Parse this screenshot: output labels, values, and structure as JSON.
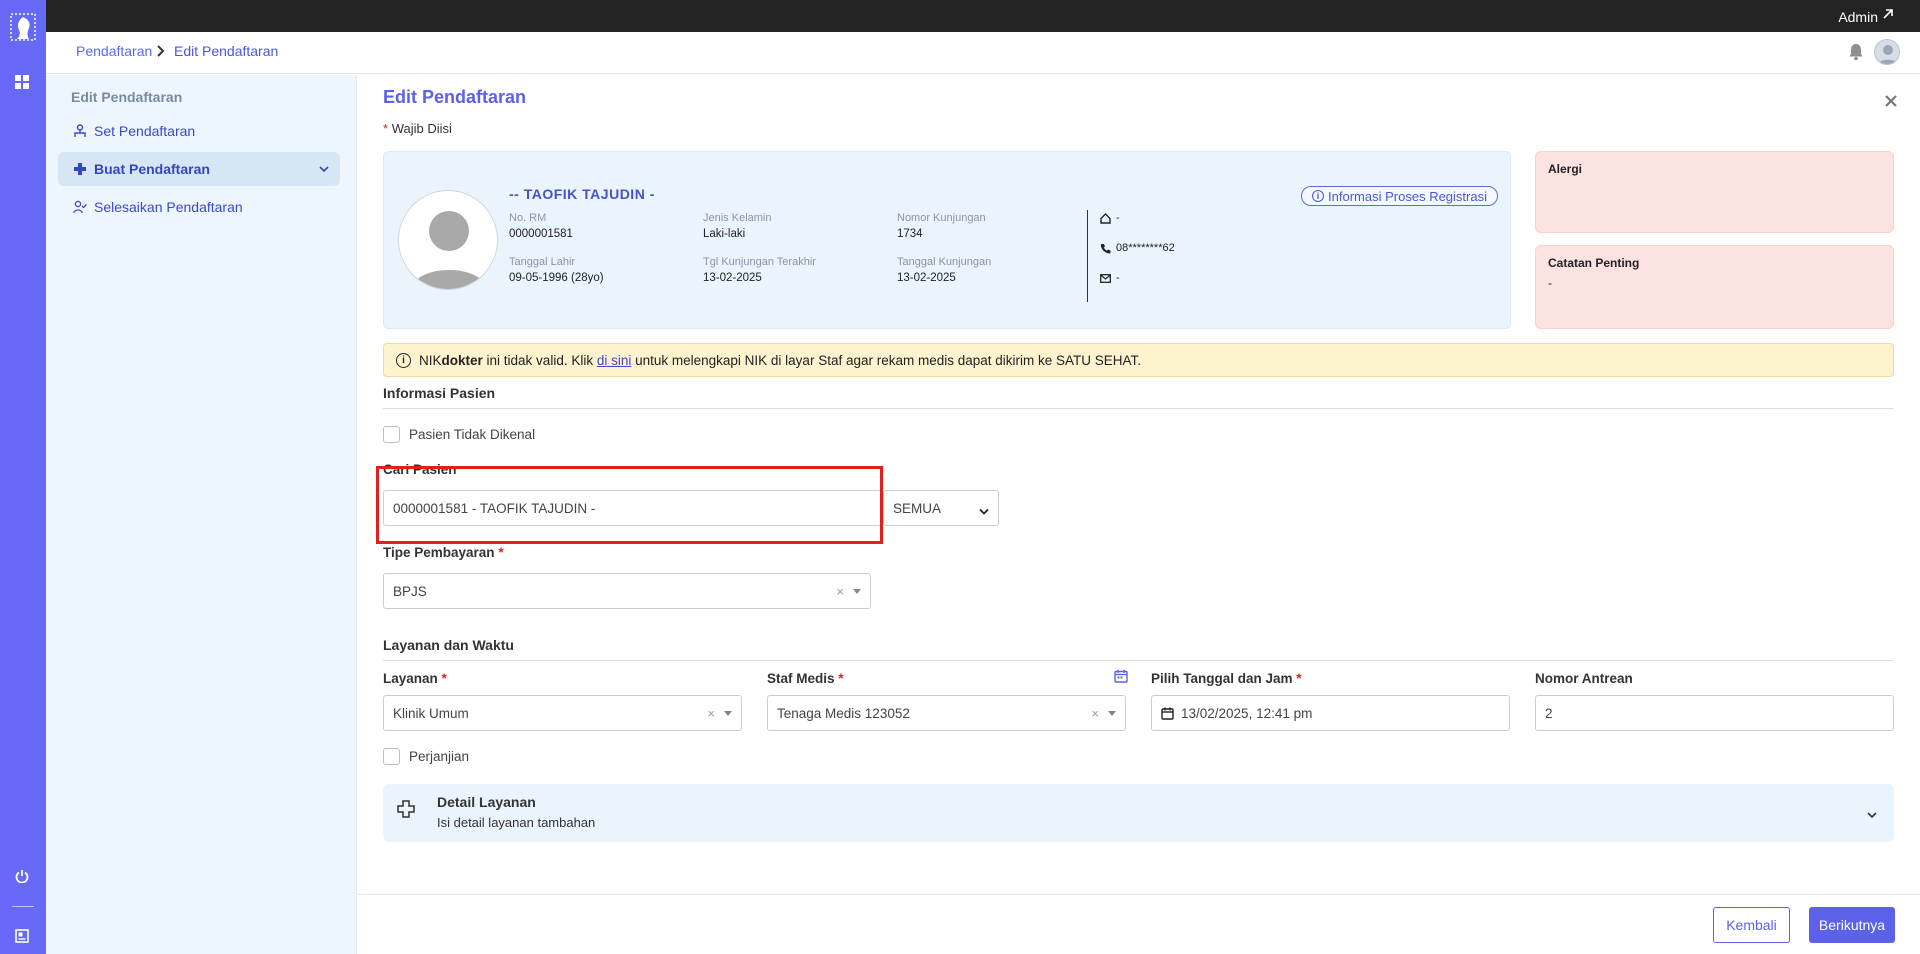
{
  "topbar": {
    "user": "Admin"
  },
  "breadcrumb": {
    "root": "Pendaftaran",
    "current": "Edit Pendaftaran"
  },
  "sidebar": {
    "title": "Edit Pendaftaran",
    "items": [
      {
        "label": "Set Pendaftaran",
        "icon": "people-icon"
      },
      {
        "label": "Buat Pendaftaran",
        "icon": "plus-cross-icon"
      },
      {
        "label": "Selesaikan Pendaftaran",
        "icon": "user-check-icon"
      }
    ]
  },
  "page": {
    "title": "Edit Pendaftaran",
    "required_note": "Wajib Diisi",
    "required_star": "*"
  },
  "patient": {
    "name": "-- TAOFIK TAJUDIN -",
    "info_button": "Informasi Proses Registrasi",
    "fields": {
      "rm_label": "No. RM",
      "rm_value": "0000001581",
      "gender_label": "Jenis Kelamin",
      "gender_value": "Laki-laki",
      "visit_no_label": "Nomor Kunjungan",
      "visit_no_value": "1734",
      "dob_label": "Tanggal Lahir",
      "dob_value": "09-05-1996 (28yo)",
      "last_visit_label": "Tgl Kunjungan Terakhir",
      "last_visit_value": "13-02-2025",
      "visit_date_label": "Tanggal Kunjungan",
      "visit_date_value": "13-02-2025"
    },
    "contact": {
      "address": "-",
      "phone": "08********62",
      "email": "-"
    }
  },
  "alergi": {
    "title": "Alergi",
    "value": ""
  },
  "catatan": {
    "title": "Catatan Penting",
    "value": "-"
  },
  "warning": {
    "pre": "NIK ",
    "bold": "dokter",
    "mid": " ini tidak valid. Klik ",
    "link": "di sini",
    "post": " untuk melengkapi NIK di layar Staf agar rekam medis dapat dikirim ke SATU SEHAT."
  },
  "informasi_pasien": {
    "heading": "Informasi Pasien",
    "unknown_checkbox": "Pasien Tidak Dikenal",
    "search_label": "Cari Pasien",
    "search_value": "0000001581 -  TAOFIK TAJUDIN -",
    "filter_value": "SEMUA",
    "payment_label": "Tipe Pembayaran",
    "payment_value": "BPJS"
  },
  "layanan": {
    "heading": "Layanan dan Waktu",
    "service_label": "Layanan",
    "service_value": "Klinik Umum",
    "staff_label": "Staf Medis",
    "staff_value": "Tenaga Medis 123052",
    "datetime_label": "Pilih Tanggal dan Jam",
    "datetime_value": "13/02/2025, 12:41 pm",
    "queue_label": "Nomor Antrean",
    "queue_value": "2",
    "appointment_checkbox": "Perjanjian"
  },
  "detail_layanan": {
    "title": "Detail Layanan",
    "subtitle": "Isi detail layanan tambahan"
  },
  "footer": {
    "back": "Kembali",
    "next": "Berikutnya"
  },
  "colors": {
    "accent": "#5b61e8",
    "rail": "#6669f5",
    "highlight": "#e0201e",
    "warning_bg": "#fdf3cf",
    "note_bg": "#fde2e2"
  }
}
